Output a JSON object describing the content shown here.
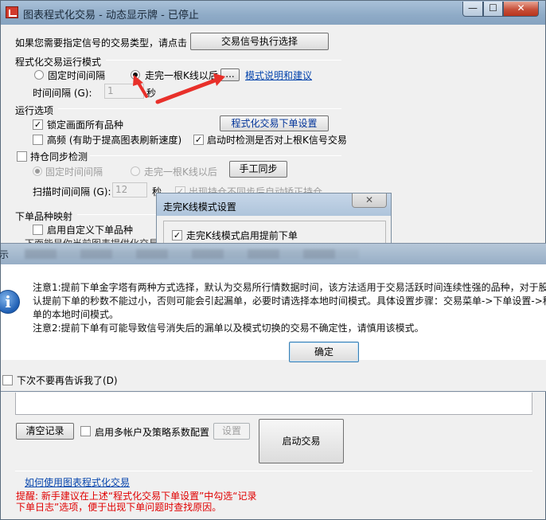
{
  "window": {
    "title": "图表程式化交易 - 动态显示牌 - 已停止",
    "min": "—",
    "max": "☐",
    "close": "✕"
  },
  "signal_type": {
    "prompt": "如果您需要指定信号的交易类型，请点击",
    "button": "交易信号执行选择"
  },
  "run_mode": {
    "header": "程式化交易运行模式",
    "fixed_interval": "固定时间间隔",
    "after_kline": "走完一根K线以后",
    "browse": "...",
    "help_link": "模式说明和建议",
    "interval_label": "时间间隔 (G):",
    "interval_value": "1",
    "interval_unit": "秒"
  },
  "run_options": {
    "header": "运行选项",
    "lock_all": "锁定画面所有品种",
    "order_settings": "程式化交易下单设置",
    "high_freq": "高频 (有助于提高图表刷新速度)",
    "check_on_start": "启动时检测是否对上根K信号交易"
  },
  "position_sync": {
    "header": "持仓同步检测",
    "fixed_interval": "固定时间间隔",
    "after_kline": "走完一根K线以后",
    "manual_sync": "手工同步",
    "scan_label": "扫描时间间隔 (G):",
    "scan_value": "12",
    "scan_unit": "秒",
    "auto_correct": "出现持仓不同步后自动矫正持仓"
  },
  "mapping": {
    "header": "下单品种映射",
    "custom": "启用自定义下单品种",
    "partial": "下面能是你当前图表提供化交易"
  },
  "kline_dialog": {
    "title": "走完K线模式设置",
    "close": "✕",
    "early_order": "走完K线模式启用提前下单"
  },
  "info_dialog": {
    "left_partial": "示",
    "icon": "i",
    "line1": "注意1:提前下单金字塔有两种方式选择，默认为交易所行情数据时间，该方法适用于交易活跃时间连续性强的品种，对于股",
    "line2": "认提前下单的秒数不能过小，否则可能会引起漏单，必要时请选择本地时间模式。具体设置步骤：交易菜单->下单设置->程",
    "line3": "单的本地时间模式。",
    "line4": "注意2:提前下单有可能导致信号消失后的漏单以及模式切换的交易不确定性，请慎用该模式。",
    "ok": "确定",
    "dont_show": "下次不要再告诉我了(D)"
  },
  "bottom": {
    "clear_log": "清空记录",
    "multi_account": "启用多帐户及策略系数配置",
    "settings": "设置",
    "start_trading": "启动交易",
    "help_link": "如何使用图表程式化交易",
    "tip_line1": "提醒: 新手建议在上述“程式化交易下单设置”中勾选“记录",
    "tip_line2": "下单日志”选项，便于出现下单问题时查找原因。"
  },
  "colors": {
    "link": "#0645ad",
    "tip": "#e00000",
    "annotation_arrow": "#e8302a"
  }
}
